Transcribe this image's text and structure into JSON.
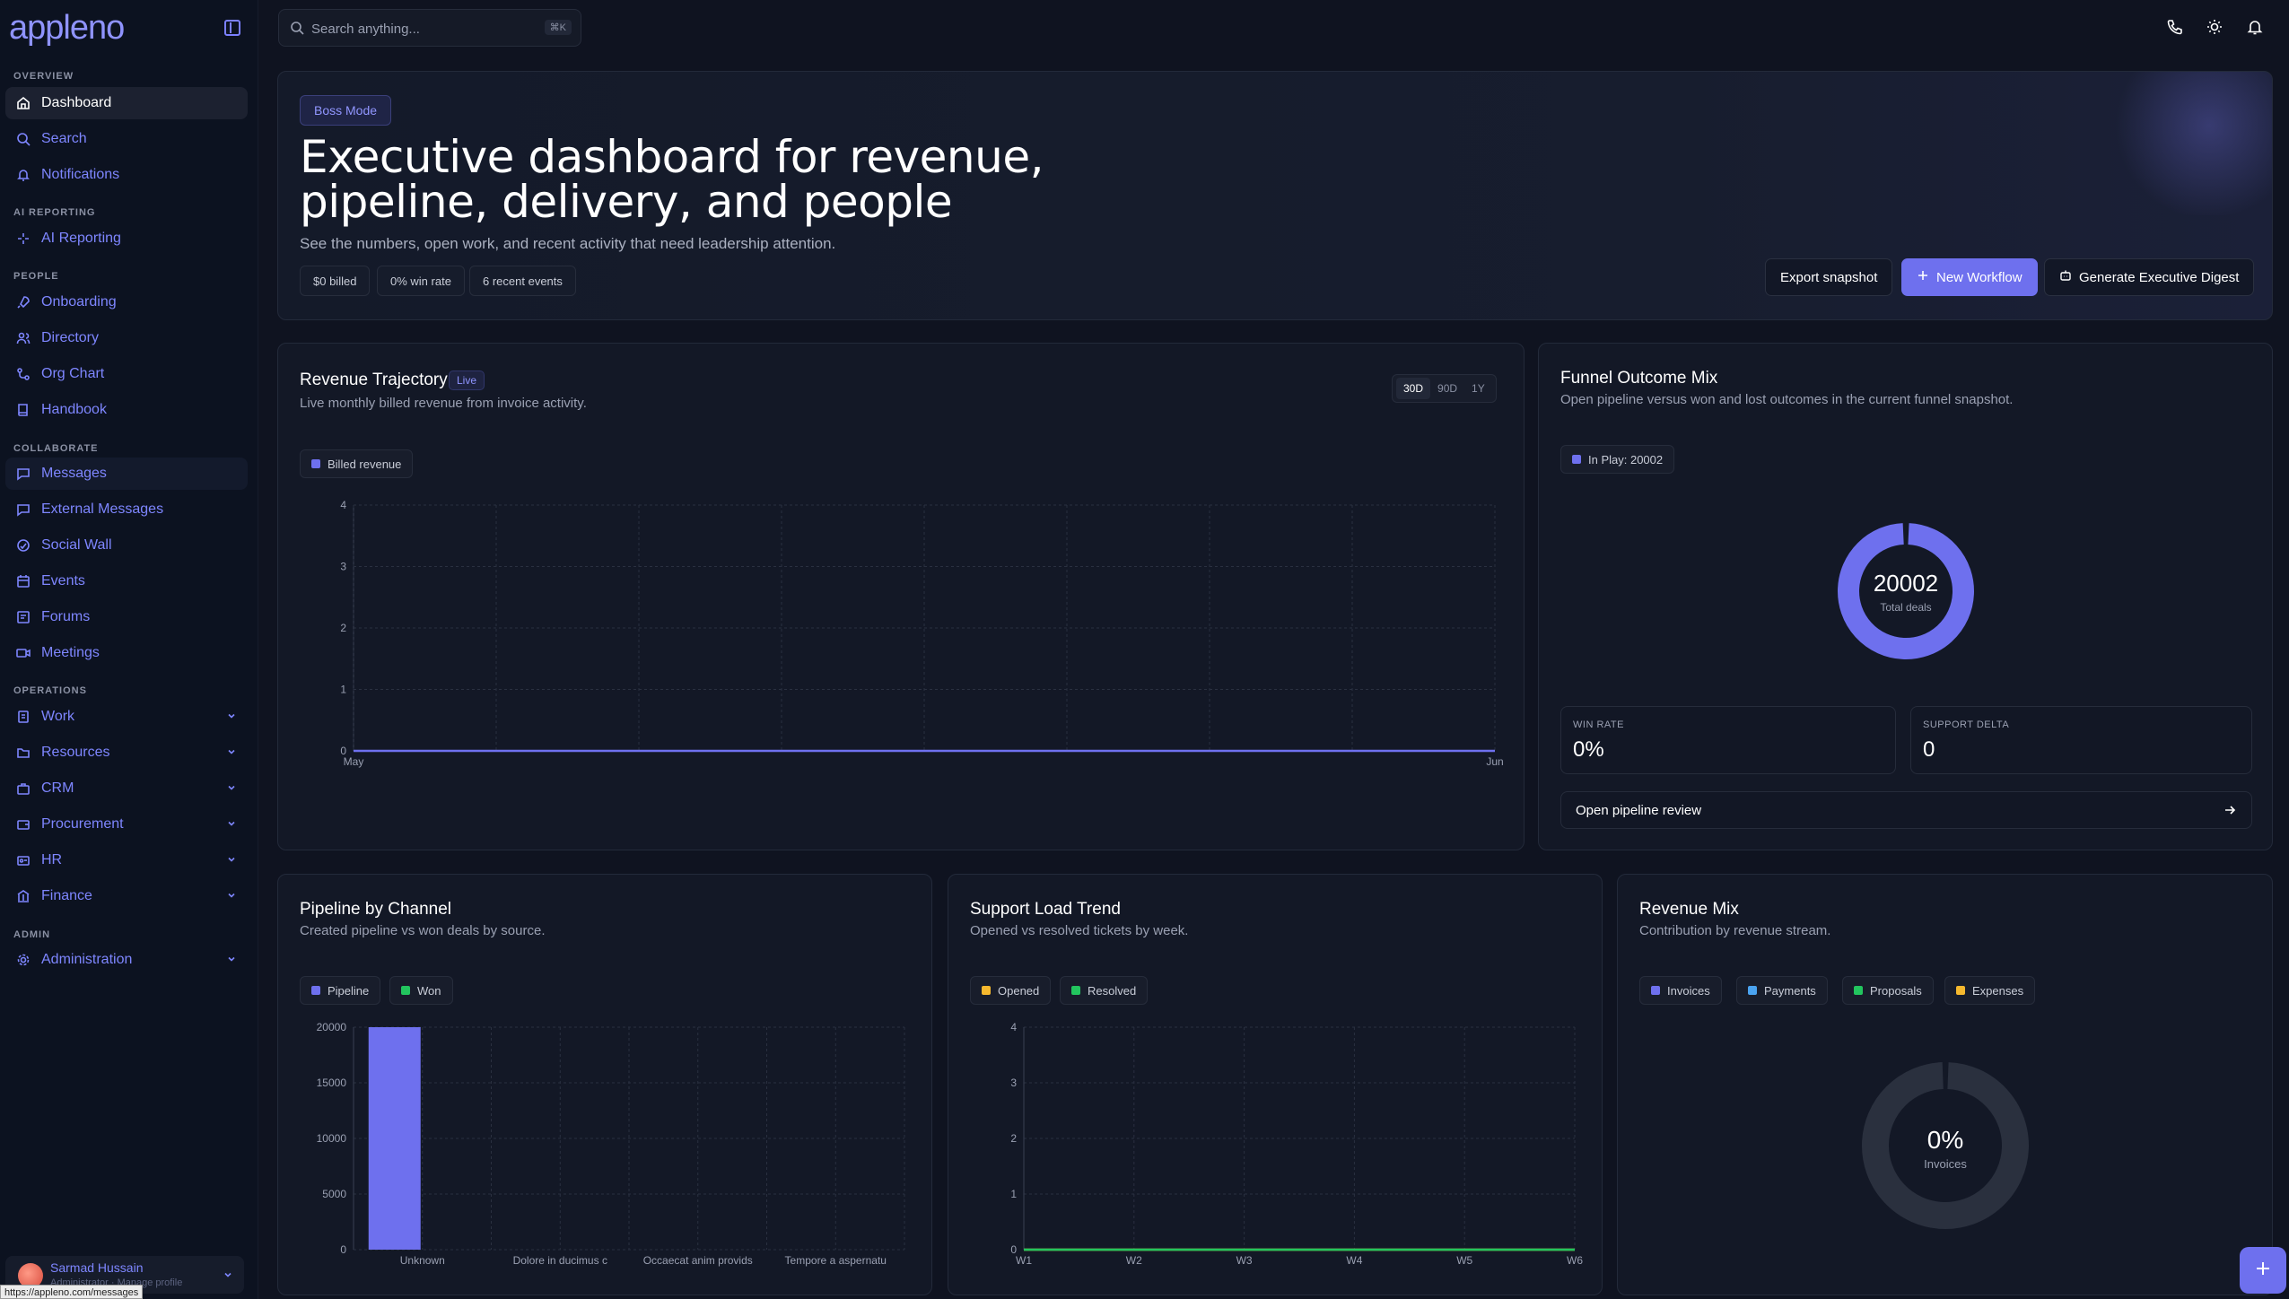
{
  "app": {
    "logo": "appleno"
  },
  "sidebar": {
    "sections": {
      "overview": "OVERVIEW",
      "ai": "AI REPORTING",
      "people": "PEOPLE",
      "collaborate": "COLLABORATE",
      "operations": "OPERATIONS",
      "admin": "ADMIN"
    },
    "items": {
      "dashboard": "Dashboard",
      "search": "Search",
      "notifications": "Notifications",
      "ai_reporting": "AI Reporting",
      "onboarding": "Onboarding",
      "directory": "Directory",
      "org_chart": "Org Chart",
      "handbook": "Handbook",
      "messages": "Messages",
      "external_messages": "External Messages",
      "social_wall": "Social Wall",
      "events": "Events",
      "forums": "Forums",
      "meetings": "Meetings",
      "work": "Work",
      "resources": "Resources",
      "crm": "CRM",
      "procurement": "Procurement",
      "hr": "HR",
      "finance": "Finance",
      "administration": "Administration"
    },
    "user": {
      "name": "Sarmad Hussain",
      "role": "Administrator · Manage profile"
    },
    "status_url": "https://appleno.com/messages"
  },
  "topbar": {
    "search_placeholder": "Search anything...",
    "search_shortcut": "⌘K"
  },
  "hero": {
    "badge": "Boss Mode",
    "title": "Executive dashboard for revenue, pipeline, delivery, and people",
    "subtitle": "See the numbers, open work, and recent activity that need leadership attention.",
    "chips": [
      "$0 billed",
      "0% win rate",
      "6 recent events"
    ],
    "buttons": {
      "export": "Export snapshot",
      "new_workflow": "New Workflow",
      "digest": "Generate Executive Digest"
    }
  },
  "revenue": {
    "title": "Revenue Trajectory",
    "badge": "Live",
    "subtitle": "Live monthly billed revenue from invoice activity.",
    "ranges": [
      "30D",
      "90D",
      "1Y"
    ],
    "selected_range": "30D",
    "legend": "Billed revenue"
  },
  "funnel": {
    "title": "Funnel Outcome Mix",
    "subtitle": "Open pipeline versus won and lost outcomes in the current funnel snapshot.",
    "legend": "In Play: 20002",
    "center_value": "20002",
    "center_label": "Total deals",
    "win_rate_label": "WIN RATE",
    "win_rate_value": "0%",
    "support_label": "SUPPORT DELTA",
    "support_value": "0",
    "link": "Open pipeline review"
  },
  "pipeline": {
    "title": "Pipeline by Channel",
    "subtitle": "Created pipeline vs won deals by source.",
    "legend": [
      "Pipeline",
      "Won"
    ]
  },
  "support": {
    "title": "Support Load Trend",
    "subtitle": "Opened vs resolved tickets by week.",
    "legend": [
      "Opened",
      "Resolved"
    ]
  },
  "mix": {
    "title": "Revenue Mix",
    "subtitle": "Contribution by revenue stream.",
    "legend": [
      "Invoices",
      "Payments",
      "Proposals",
      "Expenses"
    ],
    "center_value": "0%",
    "center_label": "Invoices"
  },
  "colors": {
    "accent": "#6e70ee",
    "won": "#22c55e",
    "opened": "#f5b82e",
    "payments": "#4aa3f0",
    "expenses": "#f5b82e"
  },
  "chart_data": [
    {
      "type": "line",
      "x": [
        "May",
        "Jun"
      ],
      "series": [
        {
          "name": "Billed revenue",
          "values": [
            0,
            0
          ]
        }
      ],
      "ylim": [
        0,
        4
      ],
      "yticks": [
        0,
        1,
        2,
        3,
        4
      ],
      "grid": true
    },
    {
      "type": "pie",
      "categories": [
        "In Play"
      ],
      "values": [
        20002
      ]
    },
    {
      "type": "bar",
      "categories": [
        "Unknown",
        "Dolore in ducimus c",
        "Occaecat anim provids",
        "Tempore a aspernatu"
      ],
      "series": [
        {
          "name": "Pipeline",
          "values": [
            20000,
            0,
            0,
            0
          ]
        },
        {
          "name": "Won",
          "values": [
            0,
            0,
            0,
            0
          ]
        }
      ],
      "ylim": [
        0,
        20000
      ],
      "yticks": [
        0,
        5000,
        10000,
        15000,
        20000
      ],
      "grid": true
    },
    {
      "type": "line",
      "x": [
        "W1",
        "W2",
        "W3",
        "W4",
        "W5",
        "W6"
      ],
      "series": [
        {
          "name": "Opened",
          "values": [
            0,
            0,
            0,
            0,
            0,
            0
          ]
        },
        {
          "name": "Resolved",
          "values": [
            0,
            0,
            0,
            0,
            0,
            0
          ]
        }
      ],
      "ylim": [
        0,
        4
      ],
      "yticks": [
        0,
        1,
        2,
        3,
        4
      ],
      "grid": true
    },
    {
      "type": "pie",
      "categories": [
        "Invoices",
        "Payments",
        "Proposals",
        "Expenses"
      ],
      "values": [
        0,
        0,
        0,
        0
      ]
    }
  ]
}
